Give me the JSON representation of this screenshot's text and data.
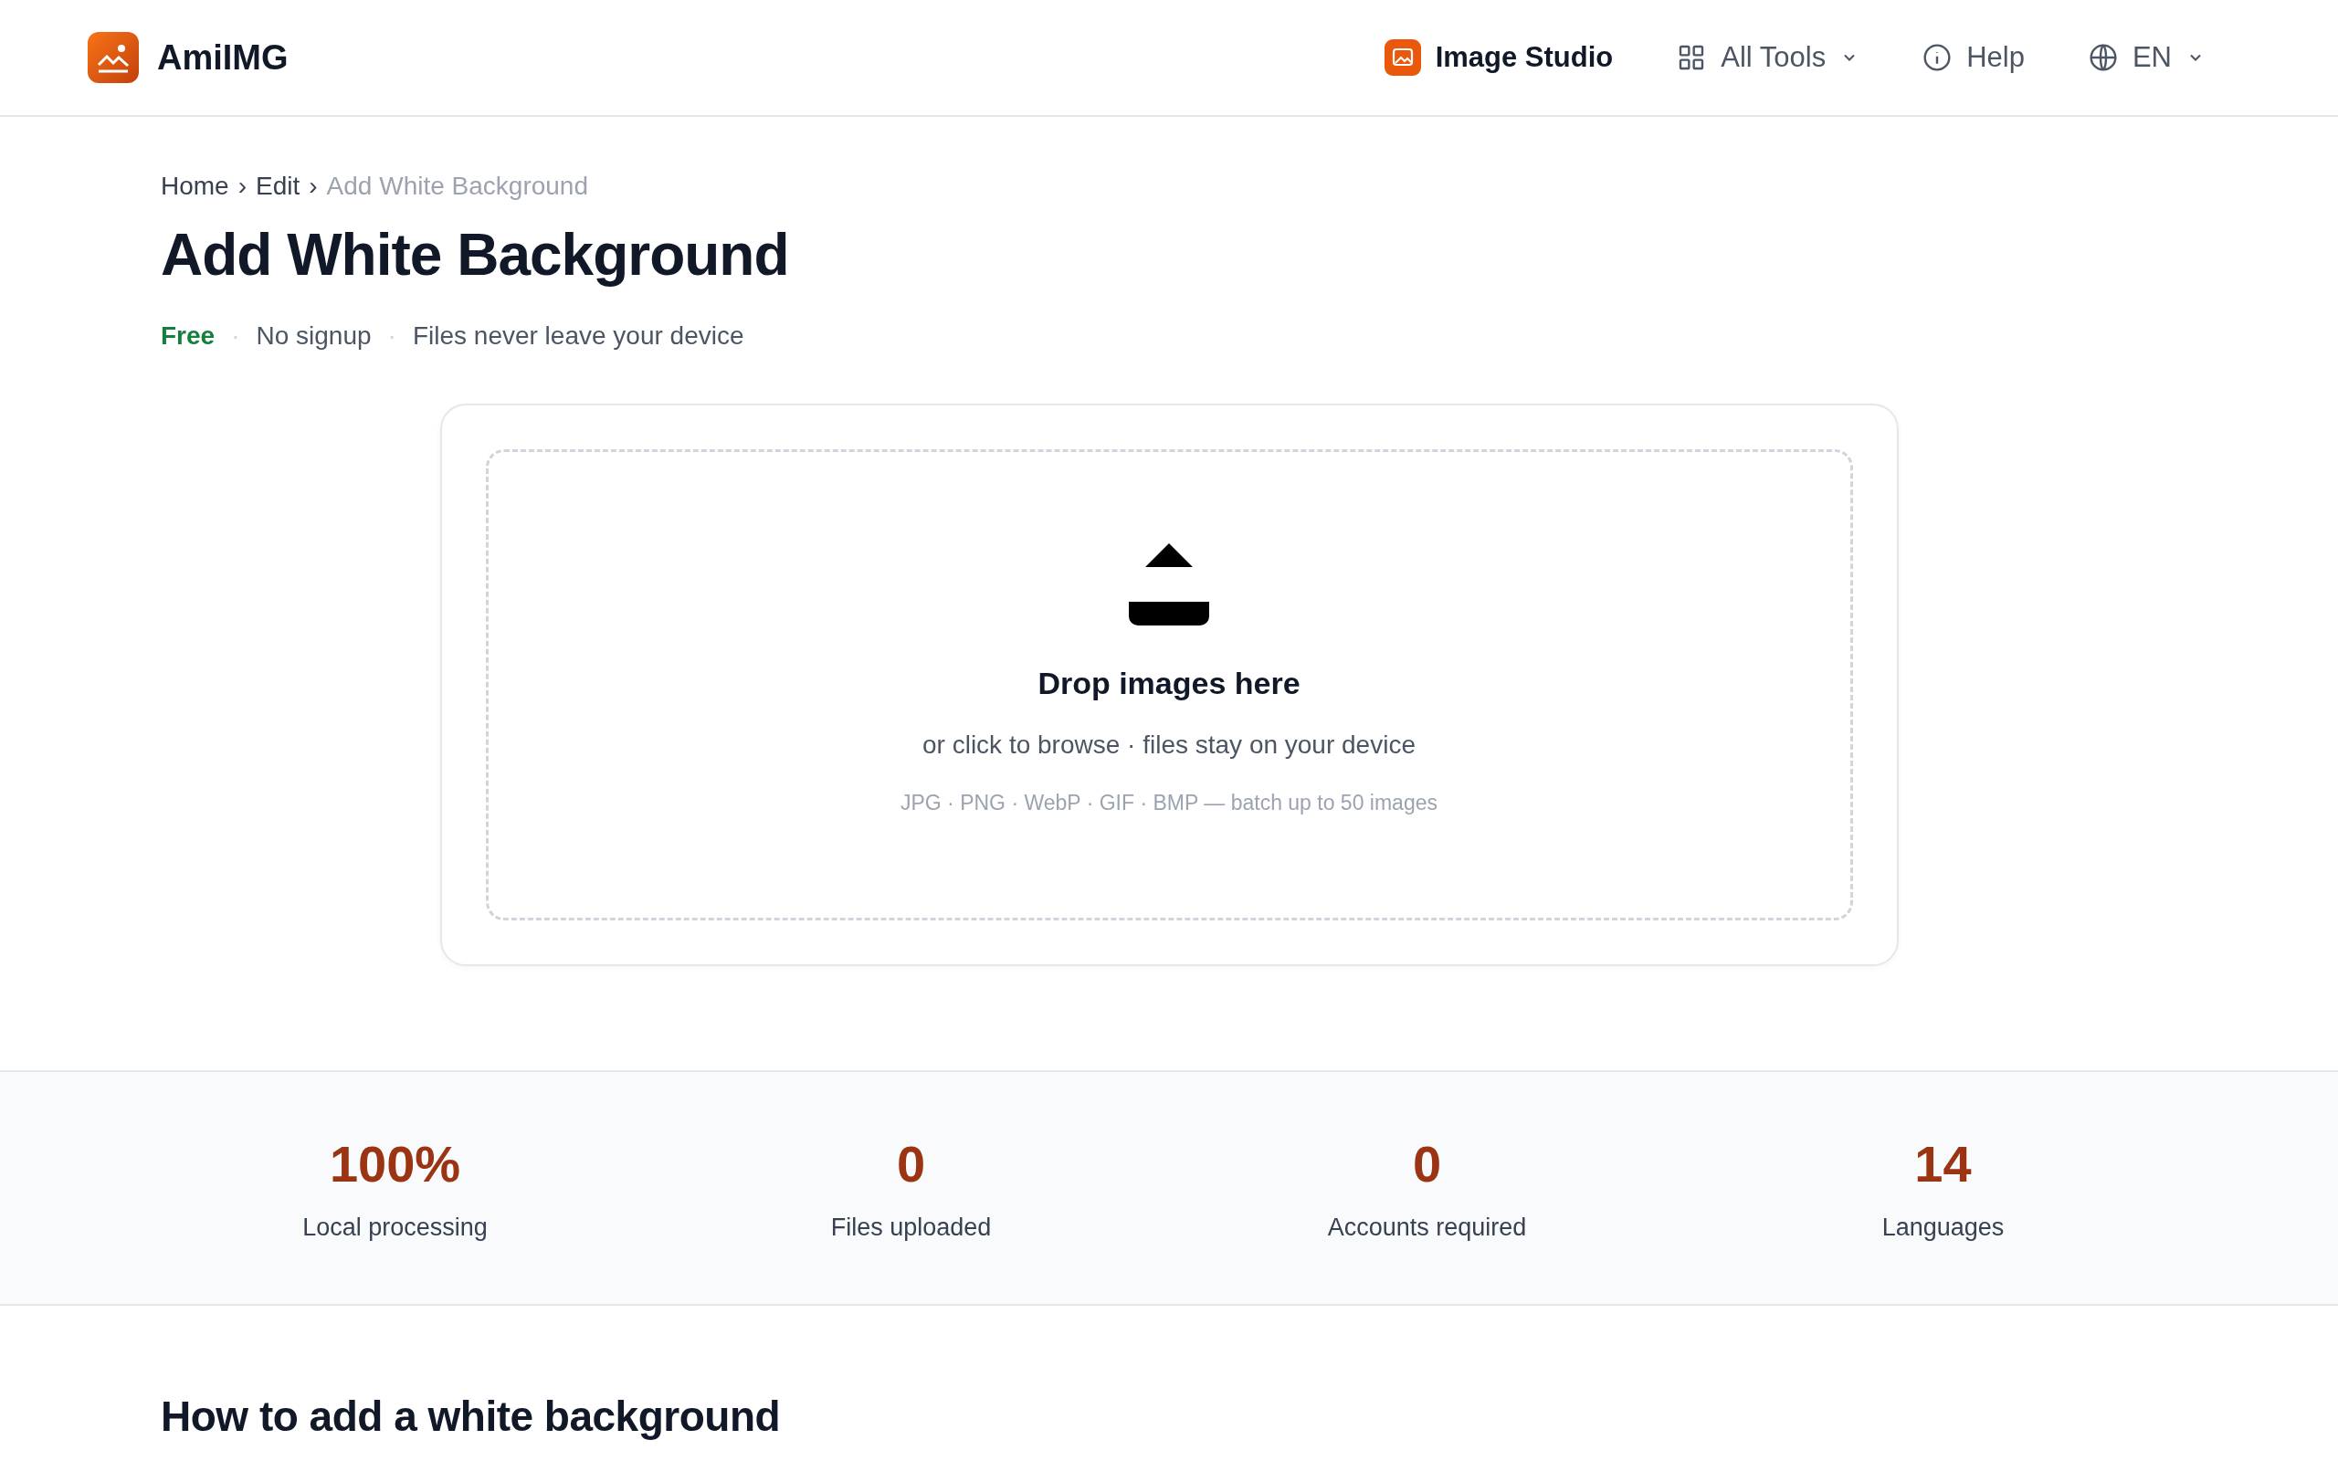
{
  "header": {
    "brand": "AmiIMG",
    "nav": [
      {
        "label": "Image Studio",
        "kind": "studio",
        "selected": true
      },
      {
        "label": "All Tools",
        "kind": "grid",
        "selected": false
      },
      {
        "label": "Help",
        "kind": "info",
        "selected": false
      },
      {
        "label": "EN",
        "kind": "language",
        "selected": false
      }
    ]
  },
  "breadcrumb": [
    {
      "label": "Home",
      "current": false
    },
    {
      "label": "Edit",
      "current": false
    },
    {
      "label": "Add White Background",
      "current": true
    }
  ],
  "breadcrumb_separator": "›",
  "title": "Add White Background",
  "badges": [
    {
      "label": "Free",
      "highlight": true
    },
    {
      "label": "No signup",
      "highlight": false
    },
    {
      "label": "Files never leave your device",
      "highlight": false
    }
  ],
  "badge_separator": "·",
  "dropzone": {
    "title": "Drop images here",
    "subtitle": "or click to browse · files stay on your device",
    "formats": "JPG · PNG · WebP · GIF · BMP — batch up to 50 images"
  },
  "stats": [
    {
      "value": "100%",
      "label": "Local processing"
    },
    {
      "value": "0",
      "label": "Files uploaded"
    },
    {
      "value": "0",
      "label": "Accounts required"
    },
    {
      "value": "14",
      "label": "Languages"
    }
  ],
  "section_heading": "How to add a white background"
}
